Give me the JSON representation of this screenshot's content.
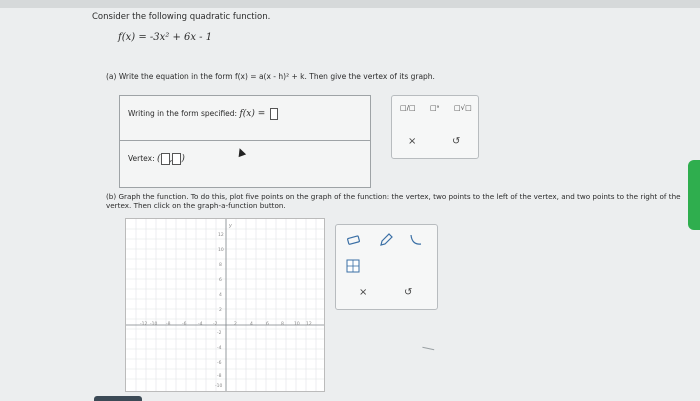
{
  "question": {
    "intro": "Consider the following quadratic function.",
    "function_text": "f(x) = -3x² + 6x - 1",
    "part_a": "(a) Write the equation in the form f(x) = a(x - h)² + k. Then give the vertex of its graph.",
    "part_b": "(b) Graph the function. To do this, plot five points on the graph of the function: the vertex, two points to the left of the vertex, and two points to the right of the vertex. Then click on the graph-a-function button."
  },
  "answer_box": {
    "form_label": "Writing in the form specified:",
    "form_math": "f(x) =",
    "vertex_label": "Vertex:"
  },
  "toolbox": {
    "fraction": "□/□",
    "superscript": "□ᵃ",
    "sqrt": "□√□",
    "clear": "×",
    "undo": "↺"
  },
  "graph": {
    "x_ticks": [
      "-12",
      "-10",
      "-8",
      "-6",
      "-4",
      "-2",
      "2",
      "4",
      "6",
      "8",
      "10",
      "12"
    ],
    "y_ticks": [
      "12",
      "10",
      "8",
      "6",
      "4",
      "2",
      "-2",
      "-4",
      "-6",
      "-8",
      "-10"
    ],
    "y_axis_label": "y"
  },
  "graph_tools": {
    "eraser": "eraser",
    "pencil": "pencil",
    "curve": "curve",
    "grid_tool": "grid",
    "clear": "×",
    "undo": "↺"
  }
}
